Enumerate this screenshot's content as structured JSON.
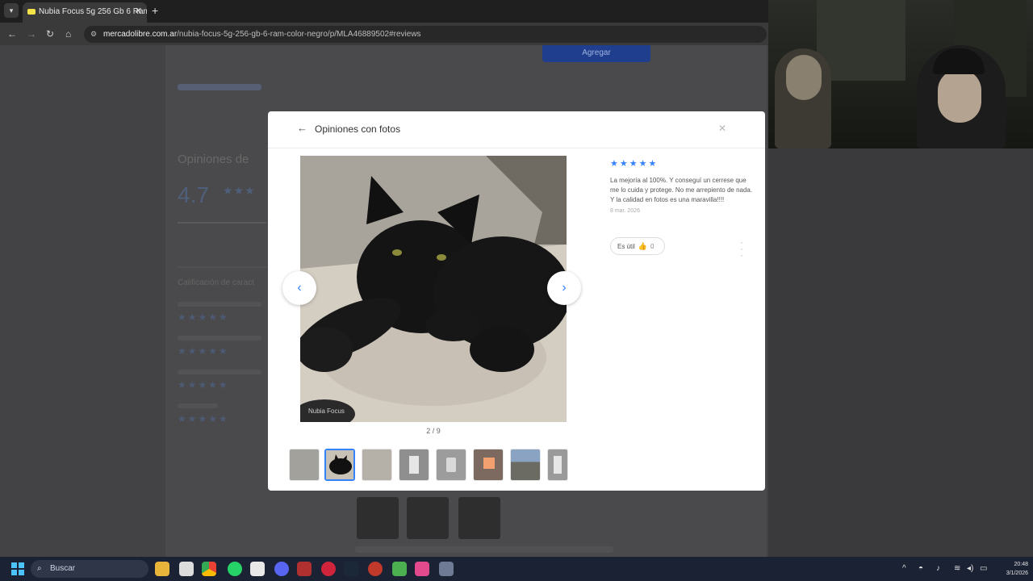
{
  "browser": {
    "tab_title": "Nubia Focus 5g 256 Gb 6 Ram",
    "tab_close": "✕",
    "new_tab": "+",
    "url_domain": "mercadolibre.com.ar",
    "url_path": "/nubia-focus-5g-256-gb-6-ram-color-negro/p/MLA46889502#reviews"
  },
  "page": {
    "buy_button": "Agregar"
  },
  "modal": {
    "back": "←",
    "title": "Opiniones con fotos",
    "close": "✕",
    "photo_watermark": "Nubia Focus",
    "prev": "‹",
    "next": "›",
    "counter": "2 / 9",
    "review": {
      "stars": "★★★★★",
      "text": "La mejoría al 100%. Y conseguí un cerrese que me lo cuida y protege. No me arrepiento de nada. Y la calidad en fotos es una maravilla!!!!",
      "date": "8 mar. 2026",
      "useful_label": "Es útil",
      "useful_count": "0",
      "thumb": "👍"
    }
  },
  "taskbar": {
    "search_placeholder": "Buscar",
    "time": "20:48",
    "date": "3/1/2026"
  },
  "colors": {
    "accent": "#3483fa",
    "taskbar": "#1b2233"
  }
}
